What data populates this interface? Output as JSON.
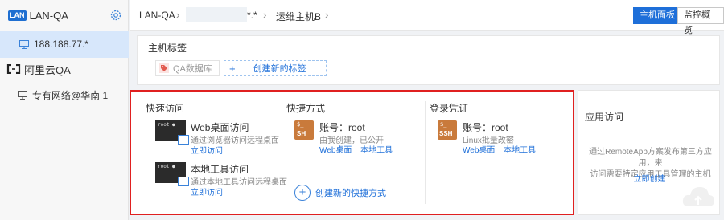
{
  "sidebar": {
    "brand_badge": "LAN",
    "title": "LAN-QA",
    "active_host": "188.188.77.*",
    "cloud_provider": "阿里云QA",
    "vpc_item": "专有网络@华南 1"
  },
  "breadcrumb": {
    "root": "LAN-QA",
    "middle_suffix": "*.*",
    "current": "运维主机B"
  },
  "header_tabs": {
    "host_panel": "主机面板",
    "monitor_overview": "监控概览"
  },
  "tags": {
    "title": "主机标签",
    "existing_tag": "QA数据库",
    "new_tag_label": "创建新的标签"
  },
  "quick_access": {
    "title": "快速访问",
    "items": [
      {
        "terminal_text": "root ●",
        "title": "Web桌面访问",
        "sub": "通过浏览器访问远程桌面",
        "link": "立即访问"
      },
      {
        "terminal_text": "root ●",
        "title": "本地工具访问",
        "sub": "通过本地工具访问远程桌面",
        "link": "立即访问"
      }
    ]
  },
  "shortcuts": {
    "title": "快捷方式",
    "item": {
      "icon_top": "$_",
      "icon_bottom": "SH",
      "title": "账号：root",
      "sub": "由我创建，已公开",
      "links": [
        "Web桌面",
        "本地工具"
      ]
    },
    "create_label": "创建新的快捷方式"
  },
  "credentials": {
    "title": "登录凭证",
    "item": {
      "icon_top": "$_",
      "icon_bottom": "SSH",
      "title": "账号：root",
      "sub": "Linux批量改密",
      "links": [
        "Web桌面",
        "本地工具"
      ]
    }
  },
  "app_access": {
    "title": "应用访问",
    "desc_line1": "通过RemoteApp方案发布第三方应用，来",
    "desc_line2": "访问需要特定应用工具管理的主机",
    "link": "立即创建"
  },
  "colors": {
    "accent": "#1e6fd9",
    "highlight_border": "#e02020",
    "sidebar_active": "#d7e7fb",
    "key_icon": "#c97a3b"
  }
}
